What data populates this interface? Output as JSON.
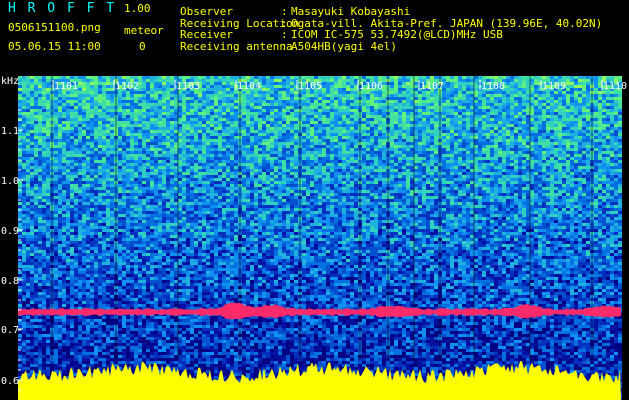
{
  "header": {
    "app_title": "H R O F F T",
    "version": "1.00",
    "filename": "0506151100.png",
    "datetime": "05.06.15 11:00",
    "meteor_label": "meteor",
    "meteor_count": "0"
  },
  "info": [
    {
      "label": "Observer",
      "value": "Masayuki Kobayashi"
    },
    {
      "label": "Receiving Location",
      "value": "Ogata-vill. Akita-Pref. JAPAN (139.96E, 40.02N)"
    },
    {
      "label": "Receiver",
      "value": "ICOM IC-575 53.7492(@LCD)MHz USB"
    },
    {
      "label": "Receiving antenna",
      "value": "A504HB(yagi 4el)"
    }
  ],
  "colon": ":",
  "axis": {
    "y_unit": "kHz",
    "y_ticks": [
      "1.1",
      "1.0",
      "0.9",
      "0.8",
      "0.7",
      "0.6"
    ],
    "x_ticks": [
      "1101",
      "1102",
      "1103",
      "1104",
      "1105",
      "1106",
      "1107",
      "1108",
      "1109",
      "1110"
    ]
  },
  "colors": {
    "background": "#000000",
    "header_yellow": "#ffff00",
    "header_cyan": "#00ffff",
    "signal_band": "#ff2a6a",
    "noise_floor": "#ffff00"
  }
}
